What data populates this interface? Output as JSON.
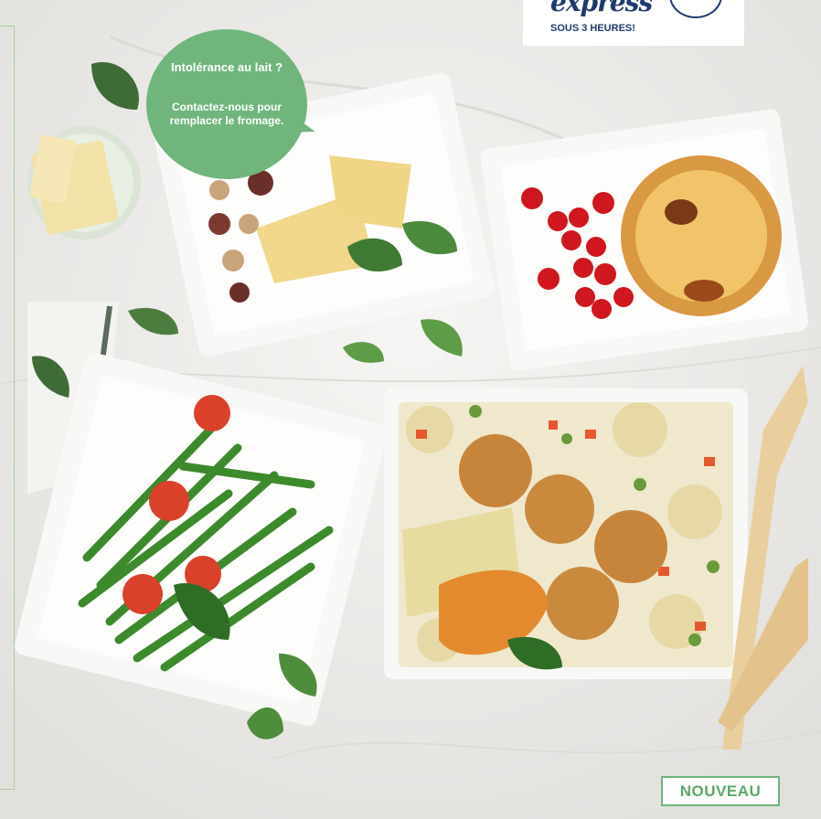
{
  "express_badge": {
    "script_text": "express",
    "subtitle": "SOUS 3 HEURES!"
  },
  "bubble": {
    "title": "Intolérance au lait ?",
    "body": "Contactez-nous pour remplacer le fromage."
  },
  "badge_new": "NOUVEAU",
  "colors": {
    "bubble_green": "#6fb57c",
    "badge_green": "#5aa86a",
    "express_navy": "#1e3a6e",
    "marble_bg": "#eceae8"
  },
  "icons": [
    "clock-icon"
  ]
}
